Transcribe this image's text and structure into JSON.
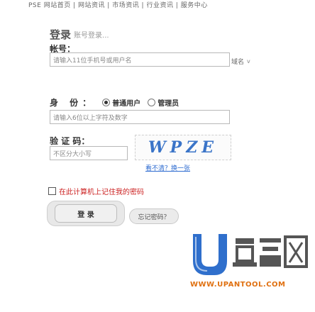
{
  "topnav": {
    "text": "PSE 网站首页 | 网站资讯 | 市场资讯 | 行业资讯 | 服务中心"
  },
  "header": {
    "title": "登录",
    "subtitle": "账号登录..."
  },
  "account": {
    "label": "帐号：",
    "placeholder": "请输入11位手机号或用户名",
    "domain_option": "域名",
    "domain_chevron": "v"
  },
  "identity": {
    "label": "身 份：",
    "options": [
      "普通用户",
      "管理员"
    ],
    "selected": 0
  },
  "password": {
    "placeholder": "请输入6位以上字符及数字"
  },
  "captcha": {
    "label": "验 证 码：",
    "placeholder": "不区分大小写",
    "image_text": "WPZE",
    "refresh_text": "看不清？换一张"
  },
  "remember": {
    "label": "在此计算机上记住我的密码"
  },
  "buttons": {
    "login": "登  录",
    "forgot": "忘记密码？"
  },
  "brand": {
    "logo_text": "U盘启动",
    "site": "WWW.UPANTOOL.COM"
  },
  "colors": {
    "accent_blue": "#2d6bd0",
    "warn_red": "#cc2222",
    "brand_orange": "#e07010"
  }
}
